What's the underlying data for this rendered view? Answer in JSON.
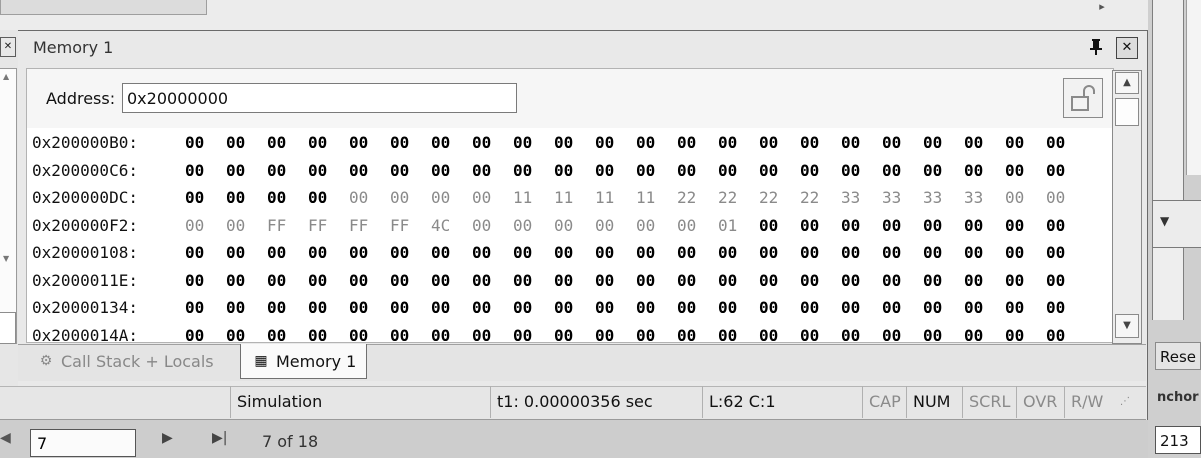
{
  "pane": {
    "title": "Memory 1"
  },
  "address": {
    "label": "Address:",
    "value": "0x20000000"
  },
  "dump_rows": [
    {
      "addr": "0x200000B0:",
      "bytes": [
        "00",
        "00",
        "00",
        "00",
        "00",
        "00",
        "00",
        "00",
        "00",
        "00",
        "00",
        "00",
        "00",
        "00",
        "00",
        "00",
        "00",
        "00",
        "00",
        "00",
        "00",
        "00"
      ],
      "highlight": [
        1,
        1,
        1,
        1,
        1,
        1,
        1,
        1,
        1,
        1,
        1,
        1,
        1,
        1,
        1,
        1,
        1,
        1,
        1,
        1,
        1,
        1
      ]
    },
    {
      "addr": "0x200000C6:",
      "bytes": [
        "00",
        "00",
        "00",
        "00",
        "00",
        "00",
        "00",
        "00",
        "00",
        "00",
        "00",
        "00",
        "00",
        "00",
        "00",
        "00",
        "00",
        "00",
        "00",
        "00",
        "00",
        "00"
      ],
      "highlight": [
        1,
        1,
        1,
        1,
        1,
        1,
        1,
        1,
        1,
        1,
        1,
        1,
        1,
        1,
        1,
        1,
        1,
        1,
        1,
        1,
        1,
        1
      ]
    },
    {
      "addr": "0x200000DC:",
      "bytes": [
        "00",
        "00",
        "00",
        "00",
        "00",
        "00",
        "00",
        "00",
        "11",
        "11",
        "11",
        "11",
        "22",
        "22",
        "22",
        "22",
        "33",
        "33",
        "33",
        "33",
        "00",
        "00"
      ],
      "highlight": [
        1,
        1,
        1,
        1,
        0,
        0,
        0,
        0,
        0,
        0,
        0,
        0,
        0,
        0,
        0,
        0,
        0,
        0,
        0,
        0,
        0,
        0
      ]
    },
    {
      "addr": "0x200000F2:",
      "bytes": [
        "00",
        "00",
        "FF",
        "FF",
        "FF",
        "FF",
        "4C",
        "00",
        "00",
        "00",
        "00",
        "00",
        "00",
        "01",
        "00",
        "00",
        "00",
        "00",
        "00",
        "00",
        "00",
        "00"
      ],
      "highlight": [
        0,
        0,
        0,
        0,
        0,
        0,
        0,
        0,
        0,
        0,
        0,
        0,
        0,
        0,
        1,
        1,
        1,
        1,
        1,
        1,
        1,
        1
      ]
    },
    {
      "addr": "0x20000108:",
      "bytes": [
        "00",
        "00",
        "00",
        "00",
        "00",
        "00",
        "00",
        "00",
        "00",
        "00",
        "00",
        "00",
        "00",
        "00",
        "00",
        "00",
        "00",
        "00",
        "00",
        "00",
        "00",
        "00"
      ],
      "highlight": [
        1,
        1,
        1,
        1,
        1,
        1,
        1,
        1,
        1,
        1,
        1,
        1,
        1,
        1,
        1,
        1,
        1,
        1,
        1,
        1,
        1,
        1
      ]
    },
    {
      "addr": "0x2000011E:",
      "bytes": [
        "00",
        "00",
        "00",
        "00",
        "00",
        "00",
        "00",
        "00",
        "00",
        "00",
        "00",
        "00",
        "00",
        "00",
        "00",
        "00",
        "00",
        "00",
        "00",
        "00",
        "00",
        "00"
      ],
      "highlight": [
        1,
        1,
        1,
        1,
        1,
        1,
        1,
        1,
        1,
        1,
        1,
        1,
        1,
        1,
        1,
        1,
        1,
        1,
        1,
        1,
        1,
        1
      ]
    },
    {
      "addr": "0x20000134:",
      "bytes": [
        "00",
        "00",
        "00",
        "00",
        "00",
        "00",
        "00",
        "00",
        "00",
        "00",
        "00",
        "00",
        "00",
        "00",
        "00",
        "00",
        "00",
        "00",
        "00",
        "00",
        "00",
        "00"
      ],
      "highlight": [
        1,
        1,
        1,
        1,
        1,
        1,
        1,
        1,
        1,
        1,
        1,
        1,
        1,
        1,
        1,
        1,
        1,
        1,
        1,
        1,
        1,
        1
      ]
    },
    {
      "addr": "0x2000014A:",
      "bytes": [
        "00",
        "00",
        "00",
        "00",
        "00",
        "00",
        "00",
        "00",
        "00",
        "00",
        "00",
        "00",
        "00",
        "00",
        "00",
        "00",
        "00",
        "00",
        "00",
        "00",
        "00",
        "00"
      ],
      "highlight": [
        1,
        1,
        1,
        1,
        1,
        1,
        1,
        1,
        1,
        1,
        1,
        1,
        1,
        1,
        1,
        1,
        1,
        1,
        1,
        1,
        1,
        1
      ]
    }
  ],
  "tabs": [
    {
      "label": "Call Stack + Locals",
      "icon": "call-stack-icon",
      "active": false
    },
    {
      "label": "Memory 1",
      "icon": "memory-window-icon",
      "active": true
    }
  ],
  "status": {
    "mode": "Simulation",
    "time": "t1: 0.00000356 sec",
    "position": "L:62 C:1",
    "cap": "CAP",
    "num": "NUM",
    "scrl": "SCRL",
    "ovr": "OVR",
    "rw": "R/W"
  },
  "navigator": {
    "current": "7",
    "count": "7 of 18"
  },
  "side": {
    "reset": "Rese",
    "anchor": "nchor",
    "number": "213"
  },
  "colors": {
    "changed_text": "#000000",
    "unchanged_text": "#8a8a8a",
    "background": "#c8c8c8"
  }
}
